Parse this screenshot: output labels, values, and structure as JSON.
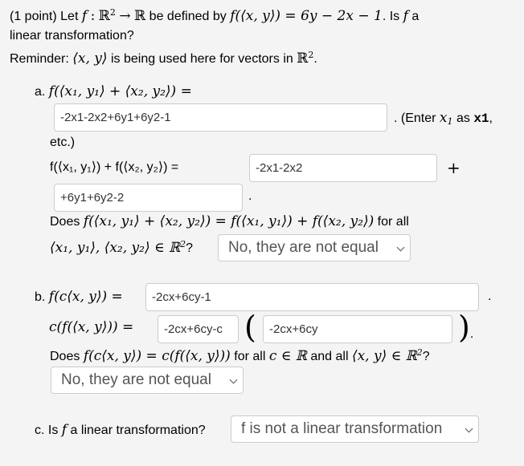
{
  "header": {
    "points": "(1 point) Let",
    "f": "f",
    "colon": ":",
    "domain": "ℝ",
    "domain_exp": "2",
    "arrow": "→",
    "codomain": "ℝ",
    "defined_by": "be defined by",
    "definition": "f(⟨x, y⟩) = 6y − 2x − 1",
    "is_f_a": ". Is",
    "f2": "f",
    "a": "a",
    "line2": "linear transformation?",
    "reminder_label": "Reminder:",
    "reminder_vec": "⟨x, y⟩",
    "reminder_text": "is being used here for vectors in",
    "reminder_space": "ℝ",
    "reminder_exp": "2",
    "reminder_end": "."
  },
  "part_a": {
    "label": "a.",
    "expr1": "f(⟨x₁, y₁⟩ + ⟨x₂, y₂⟩) =",
    "input1_value": "-2x1-2x2+6y1+6y2-1",
    "hint_prefix": ". (Enter",
    "hint_var": "x",
    "hint_sub": "1",
    "hint_as": "as",
    "hint_code": "x1",
    "hint_comma": ",",
    "hint_etc": "etc.)",
    "expr2": "f(⟨x₁, y₁⟩) + f(⟨x₂, y₂⟩) =",
    "input2_value": "-2x1-2x2",
    "plus": "+",
    "input3_value": "+6y1+6y2-2",
    "period": ".",
    "question_prefix": "Does",
    "question_expr": "f(⟨x₁, y₁⟩ + ⟨x₂, y₂⟩) = f(⟨x₁, y₁⟩) + f(⟨x₂, y₂⟩)",
    "question_forall": "for all",
    "question_line2": "⟨x₁, y₁⟩, ⟨x₂, y₂⟩ ∈ ℝ",
    "question_exp": "2",
    "question_mark": "?",
    "select_value": "No, they are not equal"
  },
  "part_b": {
    "label": "b.",
    "expr1": "f(c⟨x, y⟩) =",
    "input1_value": "-2cx+6cy-1",
    "period1": ".",
    "expr2": "c(f(⟨x, y⟩)) =",
    "input2_value": "-2cx+6cy-c",
    "open_paren": "(",
    "input3_value": "-2cx+6cy",
    "close_paren": ")",
    "period2": ".",
    "question_prefix": "Does",
    "question_expr": "f(c⟨x, y⟩) = c(f(⟨x, y⟩))",
    "question_forall": "for all",
    "question_c": "c ∈ ℝ",
    "question_and": "and all",
    "question_vec": "⟨x, y⟩ ∈ ℝ",
    "question_exp": "2",
    "question_mark": "?",
    "select_value": "No, they are not equal"
  },
  "part_c": {
    "label": "c. Is",
    "f": "f",
    "text": "a linear transformation?",
    "select_value": "f is not a linear transformation"
  }
}
